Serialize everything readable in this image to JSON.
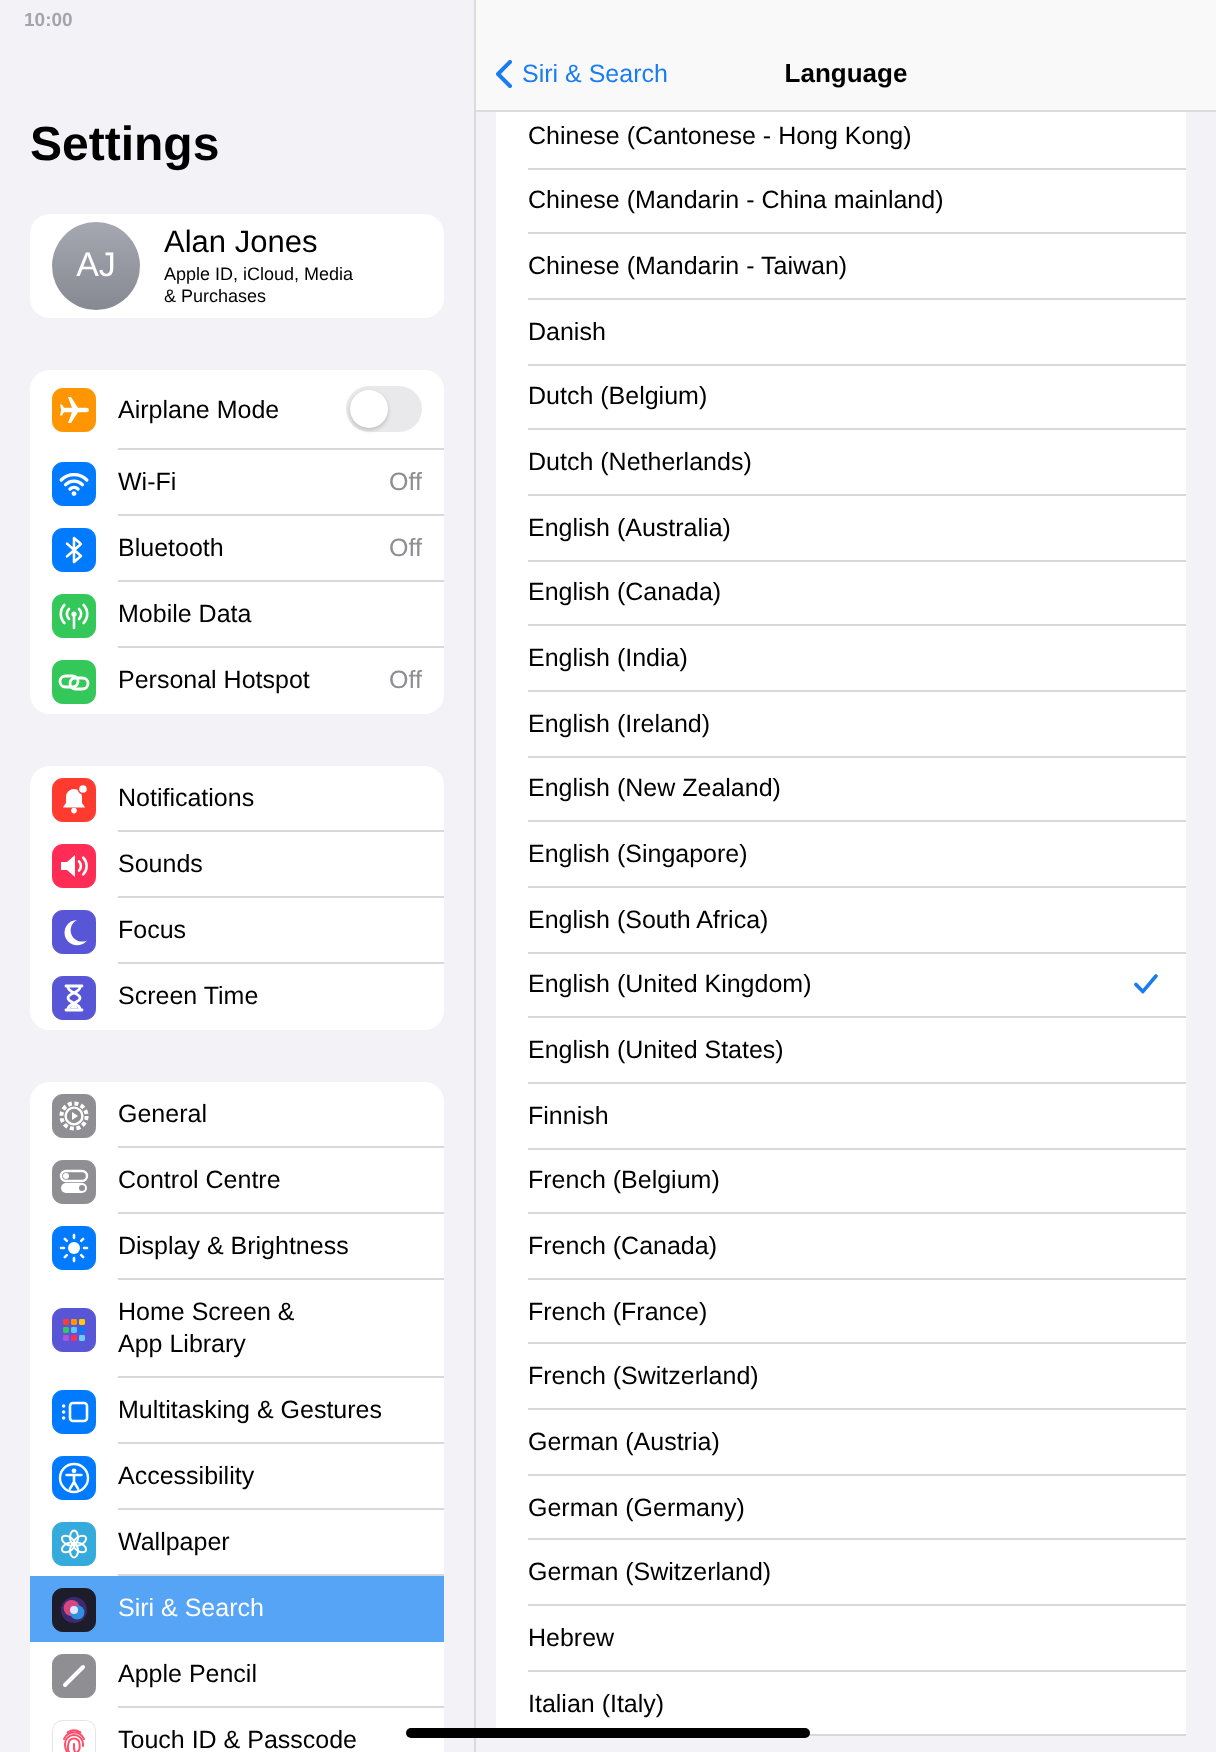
{
  "status_bar": {
    "time": "10:00"
  },
  "sidebar": {
    "title": "Settings",
    "profile": {
      "initials": "AJ",
      "name": "Alan Jones",
      "subtitle": "Apple ID, iCloud, Media\n& Purchases"
    },
    "groups": [
      {
        "items": [
          {
            "label": "Airplane Mode",
            "kind": "toggle",
            "on": false,
            "selected": false
          },
          {
            "label": "Wi-Fi",
            "kind": "value",
            "value": "Off",
            "selected": false
          },
          {
            "label": "Bluetooth",
            "kind": "value",
            "value": "Off",
            "selected": false
          },
          {
            "label": "Mobile Data",
            "kind": "plain",
            "selected": false
          },
          {
            "label": "Personal Hotspot",
            "kind": "value",
            "value": "Off",
            "selected": false
          }
        ]
      },
      {
        "items": [
          {
            "label": "Notifications",
            "kind": "plain",
            "selected": false
          },
          {
            "label": "Sounds",
            "kind": "plain",
            "selected": false
          },
          {
            "label": "Focus",
            "kind": "plain",
            "selected": false
          },
          {
            "label": "Screen Time",
            "kind": "plain",
            "selected": false
          }
        ]
      },
      {
        "items": [
          {
            "label": "General",
            "kind": "plain",
            "selected": false
          },
          {
            "label": "Control Centre",
            "kind": "plain",
            "selected": false
          },
          {
            "label": "Display & Brightness",
            "kind": "plain",
            "selected": false
          },
          {
            "label": "Home Screen &\nApp Library",
            "kind": "plain",
            "selected": false
          },
          {
            "label": "Multitasking & Gestures",
            "kind": "plain",
            "selected": false
          },
          {
            "label": "Accessibility",
            "kind": "plain",
            "selected": false
          },
          {
            "label": "Wallpaper",
            "kind": "plain",
            "selected": false
          },
          {
            "label": "Siri & Search",
            "kind": "plain",
            "selected": true
          },
          {
            "label": "Apple Pencil",
            "kind": "plain",
            "selected": false
          },
          {
            "label": "Touch ID & Passcode",
            "kind": "plain",
            "selected": false
          }
        ]
      }
    ]
  },
  "detail": {
    "nav": {
      "back": "Siri & Search",
      "title": "Language"
    },
    "languages": [
      {
        "label": "Chinese (Cantonese - Hong Kong)",
        "selected": false
      },
      {
        "label": "Chinese (Mandarin - China mainland)",
        "selected": false
      },
      {
        "label": "Chinese (Mandarin - Taiwan)",
        "selected": false
      },
      {
        "label": "Danish",
        "selected": false
      },
      {
        "label": "Dutch (Belgium)",
        "selected": false
      },
      {
        "label": "Dutch (Netherlands)",
        "selected": false
      },
      {
        "label": "English (Australia)",
        "selected": false
      },
      {
        "label": "English (Canada)",
        "selected": false
      },
      {
        "label": "English (India)",
        "selected": false
      },
      {
        "label": "English (Ireland)",
        "selected": false
      },
      {
        "label": "English (New Zealand)",
        "selected": false
      },
      {
        "label": "English (Singapore)",
        "selected": false
      },
      {
        "label": "English (South Africa)",
        "selected": false
      },
      {
        "label": "English (United Kingdom)",
        "selected": true
      },
      {
        "label": "English (United States)",
        "selected": false
      },
      {
        "label": "Finnish",
        "selected": false
      },
      {
        "label": "French (Belgium)",
        "selected": false
      },
      {
        "label": "French (Canada)",
        "selected": false
      },
      {
        "label": "French (France)",
        "selected": false
      },
      {
        "label": "French (Switzerland)",
        "selected": false
      },
      {
        "label": "German (Austria)",
        "selected": false
      },
      {
        "label": "German (Germany)",
        "selected": false
      },
      {
        "label": "German (Switzerland)",
        "selected": false
      },
      {
        "label": "Hebrew",
        "selected": false
      },
      {
        "label": "Italian (Italy)",
        "selected": false
      }
    ]
  }
}
